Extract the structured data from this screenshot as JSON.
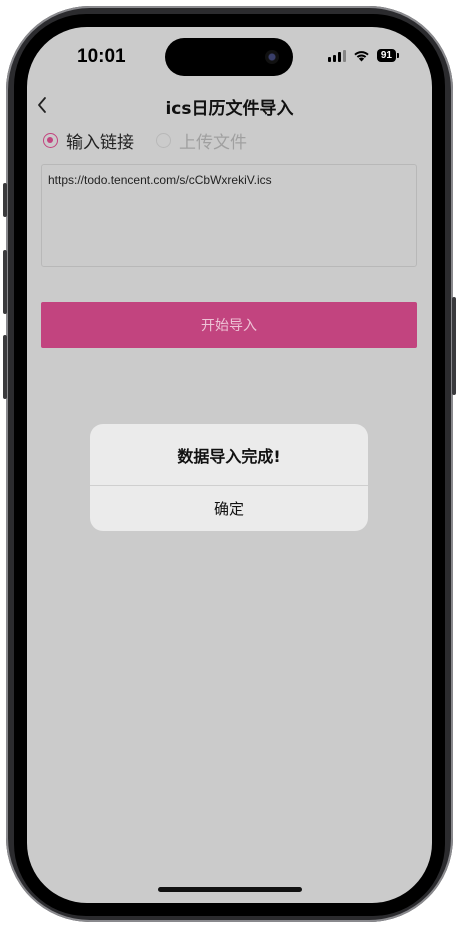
{
  "status_bar": {
    "time": "10:01",
    "battery": "91",
    "icons": [
      "signal-icon",
      "wifi-icon",
      "battery-icon"
    ]
  },
  "nav": {
    "title": "ics日历文件导入",
    "back_icon": "chevron-left-icon"
  },
  "source_options": [
    {
      "label": "输入链接",
      "selected": true
    },
    {
      "label": "上传文件",
      "selected": false
    }
  ],
  "url_input": {
    "value": "https://todo.tencent.com/s/cCbWxrekiV.ics"
  },
  "import_button": {
    "label": "开始导入"
  },
  "dialog": {
    "message": "数据导入完成!",
    "confirm_label": "确定"
  },
  "colors": {
    "accent": "#c2447f",
    "overlay_background": "#cbcbcb",
    "dialog_background": "#ebebeb"
  }
}
